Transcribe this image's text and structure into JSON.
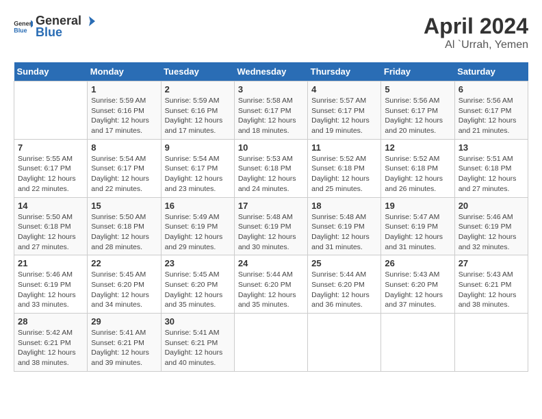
{
  "header": {
    "logo_general": "General",
    "logo_blue": "Blue",
    "title": "April 2024",
    "subtitle": "Al `Urrah, Yemen"
  },
  "days_of_week": [
    "Sunday",
    "Monday",
    "Tuesday",
    "Wednesday",
    "Thursday",
    "Friday",
    "Saturday"
  ],
  "weeks": [
    [
      {
        "day": "",
        "sunrise": "",
        "sunset": "",
        "daylight": ""
      },
      {
        "day": "1",
        "sunrise": "Sunrise: 5:59 AM",
        "sunset": "Sunset: 6:16 PM",
        "daylight": "Daylight: 12 hours and 17 minutes."
      },
      {
        "day": "2",
        "sunrise": "Sunrise: 5:59 AM",
        "sunset": "Sunset: 6:16 PM",
        "daylight": "Daylight: 12 hours and 17 minutes."
      },
      {
        "day": "3",
        "sunrise": "Sunrise: 5:58 AM",
        "sunset": "Sunset: 6:17 PM",
        "daylight": "Daylight: 12 hours and 18 minutes."
      },
      {
        "day": "4",
        "sunrise": "Sunrise: 5:57 AM",
        "sunset": "Sunset: 6:17 PM",
        "daylight": "Daylight: 12 hours and 19 minutes."
      },
      {
        "day": "5",
        "sunrise": "Sunrise: 5:56 AM",
        "sunset": "Sunset: 6:17 PM",
        "daylight": "Daylight: 12 hours and 20 minutes."
      },
      {
        "day": "6",
        "sunrise": "Sunrise: 5:56 AM",
        "sunset": "Sunset: 6:17 PM",
        "daylight": "Daylight: 12 hours and 21 minutes."
      }
    ],
    [
      {
        "day": "7",
        "sunrise": "Sunrise: 5:55 AM",
        "sunset": "Sunset: 6:17 PM",
        "daylight": "Daylight: 12 hours and 22 minutes."
      },
      {
        "day": "8",
        "sunrise": "Sunrise: 5:54 AM",
        "sunset": "Sunset: 6:17 PM",
        "daylight": "Daylight: 12 hours and 22 minutes."
      },
      {
        "day": "9",
        "sunrise": "Sunrise: 5:54 AM",
        "sunset": "Sunset: 6:17 PM",
        "daylight": "Daylight: 12 hours and 23 minutes."
      },
      {
        "day": "10",
        "sunrise": "Sunrise: 5:53 AM",
        "sunset": "Sunset: 6:18 PM",
        "daylight": "Daylight: 12 hours and 24 minutes."
      },
      {
        "day": "11",
        "sunrise": "Sunrise: 5:52 AM",
        "sunset": "Sunset: 6:18 PM",
        "daylight": "Daylight: 12 hours and 25 minutes."
      },
      {
        "day": "12",
        "sunrise": "Sunrise: 5:52 AM",
        "sunset": "Sunset: 6:18 PM",
        "daylight": "Daylight: 12 hours and 26 minutes."
      },
      {
        "day": "13",
        "sunrise": "Sunrise: 5:51 AM",
        "sunset": "Sunset: 6:18 PM",
        "daylight": "Daylight: 12 hours and 27 minutes."
      }
    ],
    [
      {
        "day": "14",
        "sunrise": "Sunrise: 5:50 AM",
        "sunset": "Sunset: 6:18 PM",
        "daylight": "Daylight: 12 hours and 27 minutes."
      },
      {
        "day": "15",
        "sunrise": "Sunrise: 5:50 AM",
        "sunset": "Sunset: 6:18 PM",
        "daylight": "Daylight: 12 hours and 28 minutes."
      },
      {
        "day": "16",
        "sunrise": "Sunrise: 5:49 AM",
        "sunset": "Sunset: 6:19 PM",
        "daylight": "Daylight: 12 hours and 29 minutes."
      },
      {
        "day": "17",
        "sunrise": "Sunrise: 5:48 AM",
        "sunset": "Sunset: 6:19 PM",
        "daylight": "Daylight: 12 hours and 30 minutes."
      },
      {
        "day": "18",
        "sunrise": "Sunrise: 5:48 AM",
        "sunset": "Sunset: 6:19 PM",
        "daylight": "Daylight: 12 hours and 31 minutes."
      },
      {
        "day": "19",
        "sunrise": "Sunrise: 5:47 AM",
        "sunset": "Sunset: 6:19 PM",
        "daylight": "Daylight: 12 hours and 31 minutes."
      },
      {
        "day": "20",
        "sunrise": "Sunrise: 5:46 AM",
        "sunset": "Sunset: 6:19 PM",
        "daylight": "Daylight: 12 hours and 32 minutes."
      }
    ],
    [
      {
        "day": "21",
        "sunrise": "Sunrise: 5:46 AM",
        "sunset": "Sunset: 6:19 PM",
        "daylight": "Daylight: 12 hours and 33 minutes."
      },
      {
        "day": "22",
        "sunrise": "Sunrise: 5:45 AM",
        "sunset": "Sunset: 6:20 PM",
        "daylight": "Daylight: 12 hours and 34 minutes."
      },
      {
        "day": "23",
        "sunrise": "Sunrise: 5:45 AM",
        "sunset": "Sunset: 6:20 PM",
        "daylight": "Daylight: 12 hours and 35 minutes."
      },
      {
        "day": "24",
        "sunrise": "Sunrise: 5:44 AM",
        "sunset": "Sunset: 6:20 PM",
        "daylight": "Daylight: 12 hours and 35 minutes."
      },
      {
        "day": "25",
        "sunrise": "Sunrise: 5:44 AM",
        "sunset": "Sunset: 6:20 PM",
        "daylight": "Daylight: 12 hours and 36 minutes."
      },
      {
        "day": "26",
        "sunrise": "Sunrise: 5:43 AM",
        "sunset": "Sunset: 6:20 PM",
        "daylight": "Daylight: 12 hours and 37 minutes."
      },
      {
        "day": "27",
        "sunrise": "Sunrise: 5:43 AM",
        "sunset": "Sunset: 6:21 PM",
        "daylight": "Daylight: 12 hours and 38 minutes."
      }
    ],
    [
      {
        "day": "28",
        "sunrise": "Sunrise: 5:42 AM",
        "sunset": "Sunset: 6:21 PM",
        "daylight": "Daylight: 12 hours and 38 minutes."
      },
      {
        "day": "29",
        "sunrise": "Sunrise: 5:41 AM",
        "sunset": "Sunset: 6:21 PM",
        "daylight": "Daylight: 12 hours and 39 minutes."
      },
      {
        "day": "30",
        "sunrise": "Sunrise: 5:41 AM",
        "sunset": "Sunset: 6:21 PM",
        "daylight": "Daylight: 12 hours and 40 minutes."
      },
      {
        "day": "",
        "sunrise": "",
        "sunset": "",
        "daylight": ""
      },
      {
        "day": "",
        "sunrise": "",
        "sunset": "",
        "daylight": ""
      },
      {
        "day": "",
        "sunrise": "",
        "sunset": "",
        "daylight": ""
      },
      {
        "day": "",
        "sunrise": "",
        "sunset": "",
        "daylight": ""
      }
    ]
  ]
}
